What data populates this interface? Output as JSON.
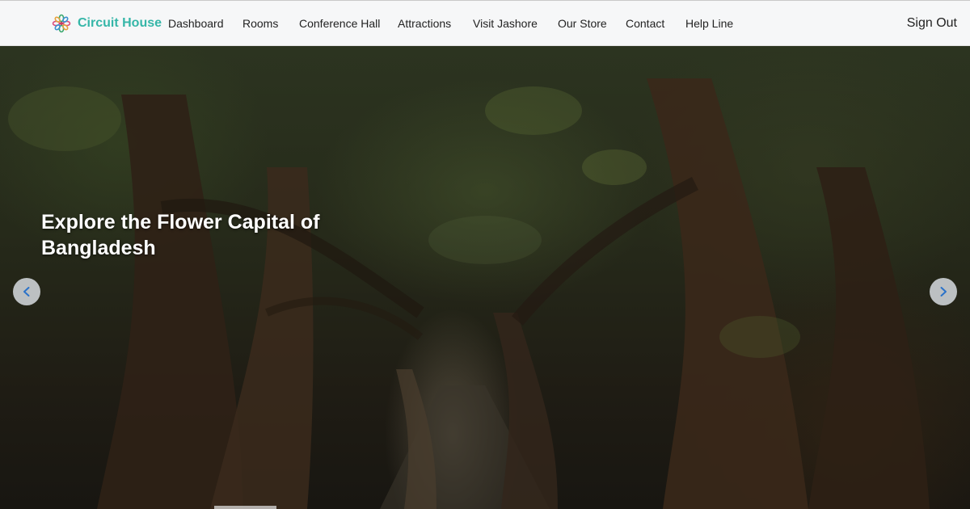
{
  "brand": {
    "name": "Circuit House",
    "logo_icon": "flower-logo-icon",
    "color": "#35b6a8"
  },
  "nav": {
    "items": [
      {
        "label": "Dashboard"
      },
      {
        "label": "Rooms"
      },
      {
        "label": "Conference Hall"
      },
      {
        "label": "Attractions"
      },
      {
        "label": "Visit Jashore"
      },
      {
        "label": "Our Store"
      },
      {
        "label": "Contact"
      },
      {
        "label": "Help Line"
      }
    ],
    "sign_out": "Sign Out"
  },
  "hero": {
    "caption": "Explore the Flower Capital of Bangladesh",
    "prev_icon": "chevron-left-icon",
    "next_icon": "chevron-right-icon",
    "arrow_color": "#2a72c9"
  }
}
